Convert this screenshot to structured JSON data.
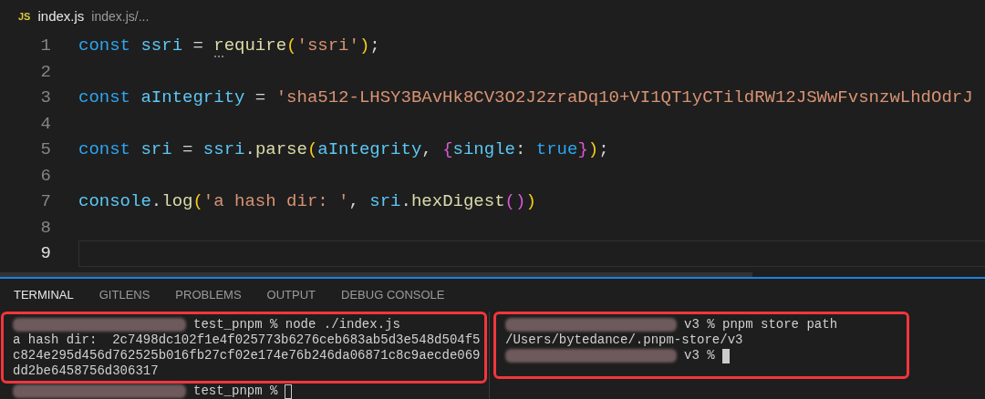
{
  "editor_tab": {
    "icon_label": "JS",
    "title": "index.js",
    "path": "index.js/..."
  },
  "code_lines": [
    {
      "number": "1",
      "current": false,
      "tokens": [
        {
          "kind": "keyword",
          "text": "const "
        },
        {
          "kind": "var",
          "text": "ssri"
        },
        {
          "kind": "punct",
          "text": " = "
        },
        {
          "kind": "func",
          "text": "require",
          "hint": true
        },
        {
          "kind": "bracket1",
          "text": "("
        },
        {
          "kind": "string",
          "text": "'ssri'"
        },
        {
          "kind": "bracket1",
          "text": ")"
        },
        {
          "kind": "punct",
          "text": ";"
        }
      ]
    },
    {
      "number": "2",
      "current": false
    },
    {
      "number": "3",
      "current": false,
      "tokens": [
        {
          "kind": "keyword",
          "text": "const "
        },
        {
          "kind": "var",
          "text": "aIntegrity"
        },
        {
          "kind": "punct",
          "text": " = "
        },
        {
          "kind": "string",
          "text": "'sha512-LHSY3BAvHk8CV3O2J2zraDq10+VI1QT1yCTildRW12JSWwFvsnzwLhdOdrJ"
        }
      ]
    },
    {
      "number": "4",
      "current": false
    },
    {
      "number": "5",
      "current": false,
      "tokens": [
        {
          "kind": "keyword",
          "text": "const "
        },
        {
          "kind": "var",
          "text": "sri"
        },
        {
          "kind": "punct",
          "text": " = "
        },
        {
          "kind": "var",
          "text": "ssri"
        },
        {
          "kind": "punct",
          "text": "."
        },
        {
          "kind": "func",
          "text": "parse"
        },
        {
          "kind": "bracket1",
          "text": "("
        },
        {
          "kind": "var",
          "text": "aIntegrity"
        },
        {
          "kind": "punct",
          "text": ", "
        },
        {
          "kind": "bracket2",
          "text": "{"
        },
        {
          "kind": "var",
          "text": "single"
        },
        {
          "kind": "punct",
          "text": ": "
        },
        {
          "kind": "keyword",
          "text": "true"
        },
        {
          "kind": "bracket2",
          "text": "}"
        },
        {
          "kind": "bracket1",
          "text": ")"
        },
        {
          "kind": "punct",
          "text": ";"
        }
      ]
    },
    {
      "number": "6",
      "current": false
    },
    {
      "number": "7",
      "current": false,
      "tokens": [
        {
          "kind": "var",
          "text": "console"
        },
        {
          "kind": "punct",
          "text": "."
        },
        {
          "kind": "func",
          "text": "log"
        },
        {
          "kind": "bracket1",
          "text": "("
        },
        {
          "kind": "string",
          "text": "'a hash dir: '"
        },
        {
          "kind": "punct",
          "text": ", "
        },
        {
          "kind": "var",
          "text": "sri"
        },
        {
          "kind": "punct",
          "text": "."
        },
        {
          "kind": "func",
          "text": "hexDigest"
        },
        {
          "kind": "bracket2",
          "text": "()"
        },
        {
          "kind": "bracket1",
          "text": ")"
        }
      ]
    },
    {
      "number": "8",
      "current": false
    },
    {
      "number": "9",
      "current": true
    }
  ],
  "panel_tabs": [
    {
      "label": "TERMINAL",
      "selected": true
    },
    {
      "label": "GITLENS",
      "selected": false
    },
    {
      "label": "PROBLEMS",
      "selected": false
    },
    {
      "label": "OUTPUT",
      "selected": false
    },
    {
      "label": "DEBUG CONSOLE",
      "selected": false
    }
  ],
  "terminals": [
    {
      "lines": [
        {
          "highlighted": true,
          "redacted": true,
          "text": "test_pnpm % node ./index.js"
        },
        {
          "highlighted": true,
          "redacted": false,
          "text": "a hash dir:  2c7498dc102f1e4f025773b6276ceb683ab5d3e548d504f5"
        },
        {
          "highlighted": true,
          "redacted": false,
          "text": "c824e295d456d762525b016fb27cf02e174e76b246da06871c8c9aecde069"
        },
        {
          "highlighted": true,
          "redacted": false,
          "text": "dd2be6458756d306317"
        },
        {
          "highlighted": false,
          "redacted": true,
          "text": "test_pnpm %",
          "cursor": true,
          "cursor_filled": false
        }
      ]
    },
    {
      "lines": [
        {
          "highlighted": true,
          "redacted": true,
          "text": "v3 % pnpm store path"
        },
        {
          "highlighted": true,
          "redacted": false,
          "text": "/Users/bytedance/.pnpm-store/v3"
        },
        {
          "highlighted": true,
          "redacted": true,
          "text": "v3 %",
          "cursor": true,
          "cursor_filled": true
        }
      ]
    }
  ]
}
